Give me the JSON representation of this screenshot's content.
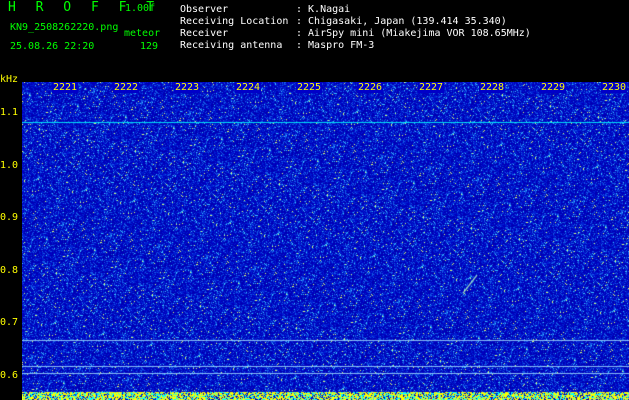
{
  "header": {
    "title": "H R O F F T",
    "version": "1.00f",
    "filename": "KN9_2508262220.png",
    "mode": "meteor",
    "datetime": "25.08.26 22:20",
    "count": "129",
    "info": [
      {
        "label": "Observer",
        "value": ": K.Nagai"
      },
      {
        "label": "Receiving Location",
        "value": ": Chigasaki, Japan (139.414 35.340)"
      },
      {
        "label": "Receiver",
        "value": ": AirSpy mini (Miakejima VOR 108.65MHz)"
      },
      {
        "label": "Receiving antenna",
        "value": ": Maspro FM-3"
      }
    ]
  },
  "colors": {
    "background": "#000000",
    "header_text": "#ffffff",
    "title_text": "#00ff00",
    "axis_text": "#ffff00",
    "spectrogram_base": "#0000c8",
    "signal_line": "#00ffff"
  },
  "chart_data": {
    "type": "heatmap",
    "ylabel": "kHz",
    "x_ticks": [
      "2221",
      "2222",
      "2223",
      "2224",
      "2225",
      "2226",
      "2227",
      "2228",
      "2229",
      "2230"
    ],
    "y_ticks": [
      "1.1",
      "1.0",
      "0.9",
      "0.8",
      "0.7",
      "0.6"
    ],
    "ylim": [
      0.58,
      1.16
    ],
    "horizontal_lines_khz": [
      1.083,
      0.667,
      0.619,
      0.604
    ],
    "meteor_echo": {
      "time": "2228",
      "khz": 0.78
    }
  }
}
